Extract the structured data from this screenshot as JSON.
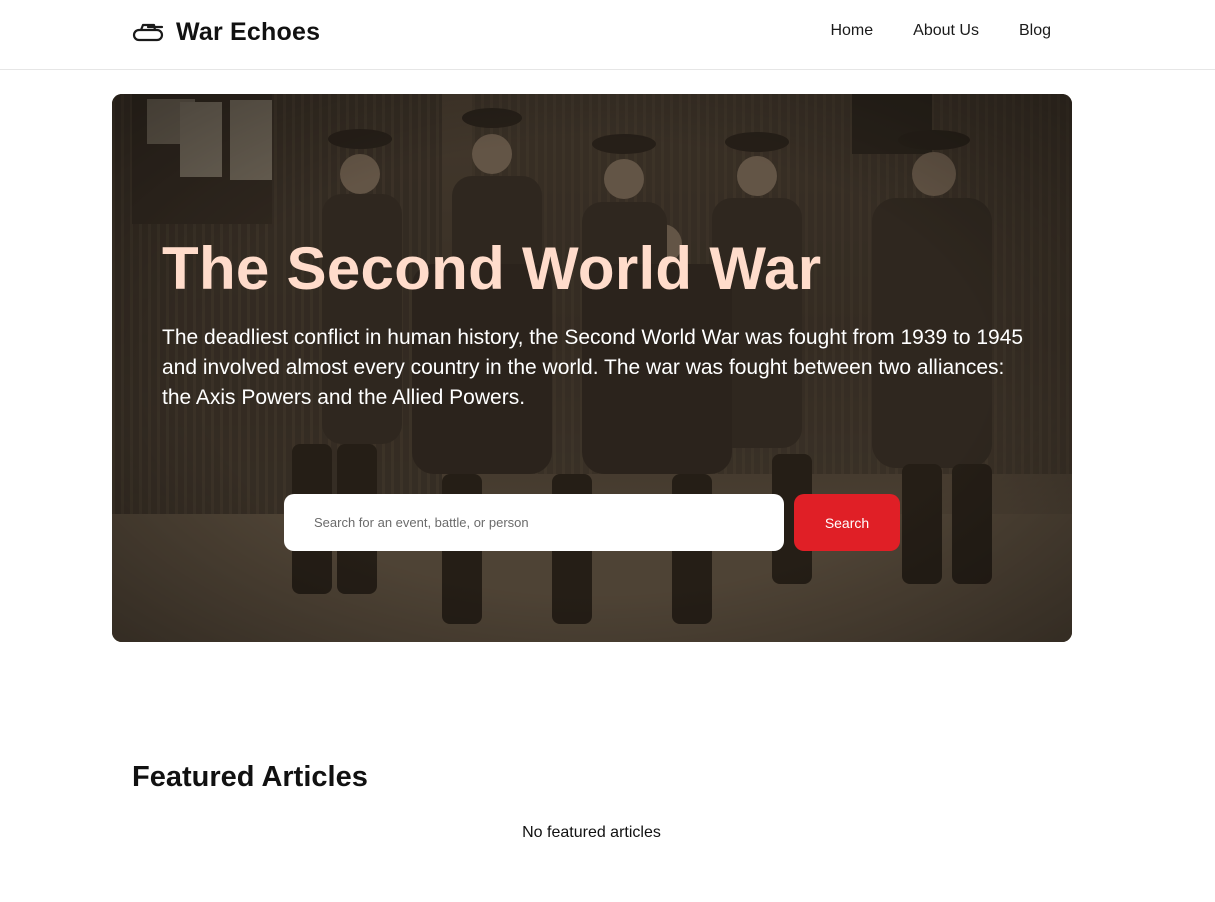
{
  "header": {
    "brand_icon": "tank-icon",
    "brand_title": "War Echoes",
    "nav": [
      {
        "label": "Home"
      },
      {
        "label": "About Us"
      },
      {
        "label": "Blog"
      }
    ]
  },
  "hero": {
    "title": "The Second World War",
    "description": "The deadliest conflict in human history, the Second World War was fought from 1939 to 1945 and involved almost every country in the world. The war was fought between two alliances: the Axis Powers and the Allied Powers.",
    "search": {
      "placeholder": "Search for an event, battle, or person",
      "value": "",
      "button_label": "Search"
    }
  },
  "featured": {
    "heading": "Featured Articles",
    "empty_message": "No featured articles"
  },
  "colors": {
    "hero_title": "#ffdccb",
    "search_button": "#e01f26",
    "text_dark": "#111111"
  }
}
